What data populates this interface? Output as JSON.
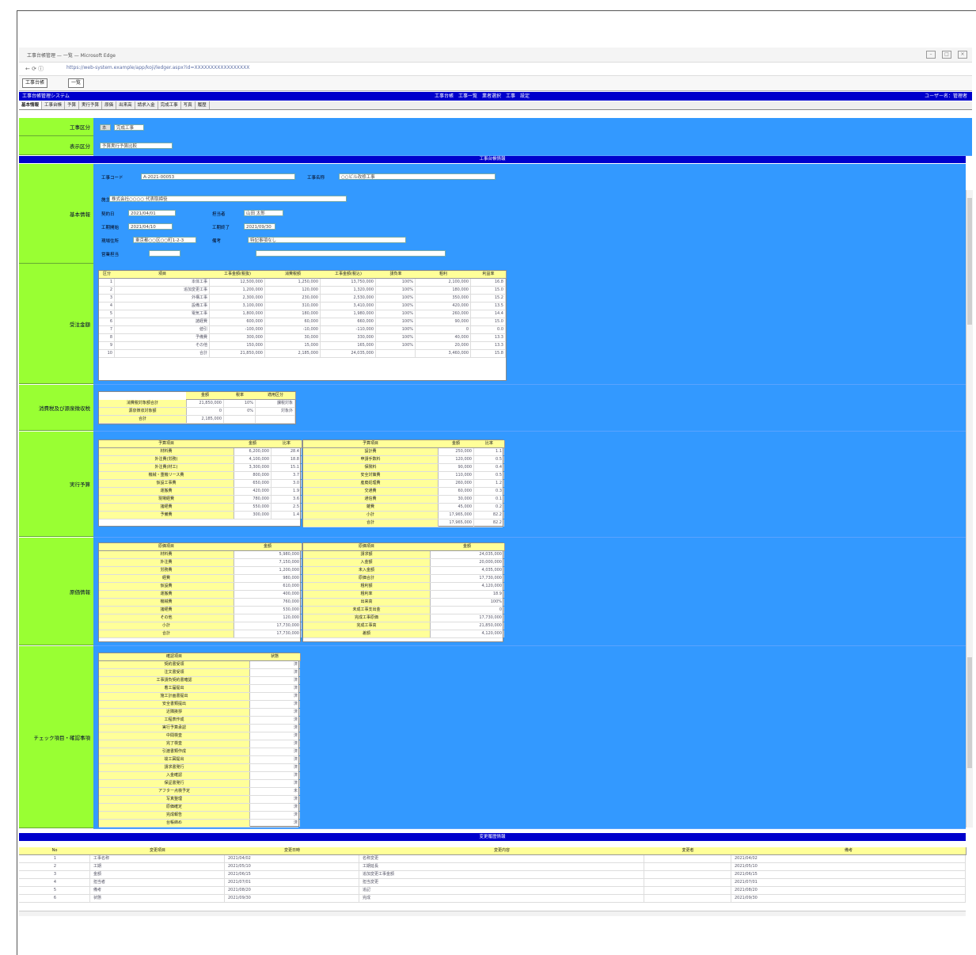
{
  "browser": {
    "window_title": "工事台帳管理 — 一覧 — Microsoft Edge",
    "address_url": "https://web-system.example/app/koji/ledger.aspx?id=XXXXXXXXXXXXXXXXX",
    "nav_symbols": "←  ⟳  ⓘ",
    "tabs": [
      "工事台帳",
      "一覧"
    ]
  },
  "app": {
    "title": "工事台帳管理システム",
    "menu": "工事台帳　工事一覧　業者選択　工事　設定",
    "user": "ユーザー名：管理者",
    "subtabs": [
      "基本情報",
      "工事台帳",
      "予算",
      "実行予算",
      "原価",
      "出来高",
      "請求入金",
      "完成工事",
      "写真",
      "履歴"
    ]
  },
  "header_section": {
    "label_1": "工事区分",
    "value_1a": "本",
    "value_1b": "完成工事",
    "label_2": "表示区分",
    "value_2": "予算実行予算比較"
  },
  "bars": {
    "top": "工事台帳情報",
    "bottom": "変更履歴情報"
  },
  "basic": {
    "label": "基本情報",
    "code_label": "工事コード",
    "code_value": "A-2021-00053",
    "name_label": "工事名称",
    "name_value": "○○ビル改修工事",
    "fields": [
      {
        "label": "施主",
        "value": "株式会社○○○○ 代表取締役"
      },
      {
        "label": "契約日",
        "value": "2021/04/01"
      },
      {
        "label": "担当者",
        "value": "山田 太郎"
      },
      {
        "label": "工期開始",
        "value": "2021/04/10"
      },
      {
        "label": "工期終了",
        "value": "2021/09/30"
      },
      {
        "label": "現場住所",
        "value": "東京都○○区○○町1-2-3"
      },
      {
        "label": "備考",
        "value": "特記事項なし"
      },
      {
        "label": "営業担当",
        "value": ""
      }
    ]
  },
  "order": {
    "label": "受注金額",
    "headers": [
      "区分",
      "項目",
      "工事金額(税抜)",
      "消費税額",
      "工事金額(税込)",
      "請負率",
      "粗利",
      "利益率"
    ],
    "rows": [
      [
        "1",
        "本体工事",
        "12,500,000",
        "1,250,000",
        "13,750,000",
        "100%",
        "2,100,000",
        "16.8"
      ],
      [
        "2",
        "追加変更工事",
        "1,200,000",
        "120,000",
        "1,320,000",
        "100%",
        "180,000",
        "15.0"
      ],
      [
        "3",
        "外構工事",
        "2,300,000",
        "230,000",
        "2,530,000",
        "100%",
        "350,000",
        "15.2"
      ],
      [
        "4",
        "設備工事",
        "3,100,000",
        "310,000",
        "3,410,000",
        "100%",
        "420,000",
        "13.5"
      ],
      [
        "5",
        "電気工事",
        "1,800,000",
        "180,000",
        "1,980,000",
        "100%",
        "260,000",
        "14.4"
      ],
      [
        "6",
        "諸経費",
        "600,000",
        "60,000",
        "660,000",
        "100%",
        "90,000",
        "15.0"
      ],
      [
        "7",
        "値引",
        "-100,000",
        "-10,000",
        "-110,000",
        "100%",
        "0",
        "0.0"
      ],
      [
        "8",
        "予備費",
        "300,000",
        "30,000",
        "330,000",
        "100%",
        "40,000",
        "13.3"
      ],
      [
        "9",
        "その他",
        "150,000",
        "15,000",
        "165,000",
        "100%",
        "20,000",
        "13.3"
      ],
      [
        "10",
        "合計",
        "21,850,000",
        "2,185,000",
        "24,035,000",
        "",
        "3,460,000",
        "15.8"
      ]
    ]
  },
  "tax": {
    "label": "消費税及び源泉徴収税",
    "headers": [
      "金額",
      "税率",
      "適用区分"
    ],
    "rows": [
      [
        "消費税対象額合計",
        "21,850,000",
        "10%",
        "課税対象"
      ],
      [
        "源泉徴収対象額",
        "0",
        "0%",
        "対象外"
      ],
      [
        "合計",
        "2,185,000",
        "",
        ""
      ]
    ]
  },
  "budget": {
    "label": "実行予算",
    "left_headers": [
      "予算項目",
      "金額",
      "比率"
    ],
    "left_rows": [
      [
        "材料費",
        "6,200,000",
        "28.4"
      ],
      [
        "外注費(労務)",
        "4,100,000",
        "18.8"
      ],
      [
        "外注費(材工)",
        "3,300,000",
        "15.1"
      ],
      [
        "機械・重機リース費",
        "800,000",
        "3.7"
      ],
      [
        "仮設工事費",
        "650,000",
        "3.0"
      ],
      [
        "運搬費",
        "420,000",
        "1.9"
      ],
      [
        "現場経費",
        "780,000",
        "3.6"
      ],
      [
        "諸経費",
        "550,000",
        "2.5"
      ],
      [
        "予備費",
        "300,000",
        "1.4"
      ]
    ],
    "right_headers": [
      "予算項目",
      "金額",
      "比率"
    ],
    "right_rows": [
      [
        "設計費",
        "250,000",
        "1.1"
      ],
      [
        "申請手数料",
        "120,000",
        "0.5"
      ],
      [
        "保険料",
        "90,000",
        "0.4"
      ],
      [
        "安全対策費",
        "110,000",
        "0.5"
      ],
      [
        "産廃処理費",
        "260,000",
        "1.2"
      ],
      [
        "交通費",
        "60,000",
        "0.3"
      ],
      [
        "通信費",
        "30,000",
        "0.1"
      ],
      [
        "雑費",
        "45,000",
        "0.2"
      ],
      [
        "小計",
        "17,965,000",
        "82.2"
      ],
      [
        "合計",
        "17,965,000",
        "82.2"
      ]
    ]
  },
  "cost": {
    "label": "原価情報",
    "left_headers": [
      "原価項目",
      "金額"
    ],
    "left_rows": [
      [
        "材料費",
        "5,980,000"
      ],
      [
        "外注費",
        "7,150,000"
      ],
      [
        "労務費",
        "1,200,000"
      ],
      [
        "経費",
        "980,000"
      ],
      [
        "仮設費",
        "610,000"
      ],
      [
        "運搬費",
        "400,000"
      ],
      [
        "機械費",
        "760,000"
      ],
      [
        "諸経費",
        "530,000"
      ],
      [
        "その他",
        "120,000"
      ],
      [
        "小計",
        "17,730,000"
      ],
      [
        "合計",
        "17,730,000"
      ]
    ],
    "right_headers": [
      "原価項目",
      "金額"
    ],
    "right_rows": [
      [
        "請求額",
        "24,035,000"
      ],
      [
        "入金額",
        "20,000,000"
      ],
      [
        "未入金額",
        "4,035,000"
      ],
      [
        "原価合計",
        "17,730,000"
      ],
      [
        "粗利額",
        "4,120,000"
      ],
      [
        "粗利率",
        "18.9"
      ],
      [
        "出来高",
        "100%"
      ],
      [
        "未成工事支出金",
        "0"
      ],
      [
        "完成工事原価",
        "17,730,000"
      ],
      [
        "完成工事高",
        "21,850,000"
      ],
      [
        "差額",
        "4,120,000"
      ]
    ]
  },
  "check": {
    "label": "チェック項目・確認事項",
    "headers": [
      "確認項目",
      "状態"
    ],
    "rows": [
      [
        "契約書受領",
        "済"
      ],
      [
        "注文書受領",
        "済"
      ],
      [
        "工事請負契約書確認",
        "済"
      ],
      [
        "着工届提出",
        "済"
      ],
      [
        "施工計画書提出",
        "済"
      ],
      [
        "安全書類提出",
        "済"
      ],
      [
        "近隣挨拶",
        "済"
      ],
      [
        "工程表作成",
        "済"
      ],
      [
        "実行予算承認",
        "済"
      ],
      [
        "中間検査",
        "済"
      ],
      [
        "完了検査",
        "済"
      ],
      [
        "引渡書類作成",
        "済"
      ],
      [
        "竣工図提出",
        "済"
      ],
      [
        "請求書発行",
        "済"
      ],
      [
        "入金確認",
        "済"
      ],
      [
        "保証書発行",
        "済"
      ],
      [
        "アフター点検予定",
        "未"
      ],
      [
        "写真整理",
        "済"
      ],
      [
        "原価確定",
        "済"
      ],
      [
        "完成報告",
        "済"
      ],
      [
        "台帳締め",
        "済"
      ]
    ]
  },
  "history": {
    "headers": [
      "No",
      "変更項目",
      "変更日時",
      "変更内容",
      "変更者",
      "備考"
    ],
    "rows": [
      [
        "1",
        "工事名称",
        "2021/04/02",
        "名称変更",
        "",
        "2021/04/02"
      ],
      [
        "2",
        "工期",
        "2021/05/10",
        "工期延長",
        "",
        "2021/05/10"
      ],
      [
        "3",
        "金額",
        "2021/06/15",
        "追加変更工事金額",
        "",
        "2021/06/15"
      ],
      [
        "4",
        "担当者",
        "2021/07/01",
        "担当変更",
        "",
        "2021/07/01"
      ],
      [
        "5",
        "備考",
        "2021/08/20",
        "追記",
        "",
        "2021/08/20"
      ],
      [
        "6",
        "状態",
        "2021/09/30",
        "完成",
        "",
        "2021/09/30"
      ]
    ]
  }
}
